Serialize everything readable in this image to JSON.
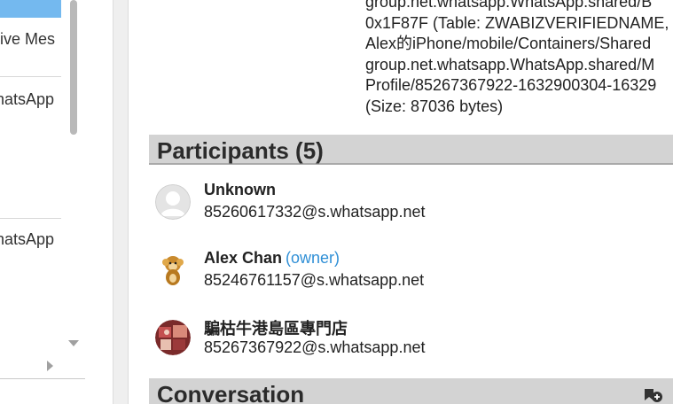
{
  "left_list": {
    "items": [
      {
        "text": "tive Mes"
      },
      {
        "text": "hatsApp"
      },
      {
        "text": "hatsApp"
      }
    ]
  },
  "source": {
    "lines": [
      "group.net.whatsapp.WhatsApp.shared/B",
      "0x1F87F (Table: ZWABIZVERIFIEDNAME,",
      "Alex的iPhone/mobile/Containers/Shared",
      "group.net.whatsapp.WhatsApp.shared/M",
      "Profile/85267367922-1632900304-16329",
      "(Size: 87036 bytes)"
    ]
  },
  "participants_section": {
    "title": "Participants (5)",
    "items": [
      {
        "name": "Unknown",
        "role": "",
        "jid": "85260617332@s.whatsapp.net",
        "avatar": "default-avatar"
      },
      {
        "name": "Alex Chan",
        "role": "(owner)",
        "jid": "85246761157@s.whatsapp.net",
        "avatar": "monkey-avatar"
      },
      {
        "name": "騙枯牛港島區專門店",
        "role": "",
        "jid": "85267367922@s.whatsapp.net",
        "avatar": "photo-avatar"
      }
    ]
  },
  "conversation_section": {
    "title": "Conversation",
    "icon": "add-bookmark-icon"
  },
  "colors": {
    "selection": "#74b9ef",
    "section_header_bg": "#d3d3d3",
    "owner_link": "#2f8fd6"
  }
}
